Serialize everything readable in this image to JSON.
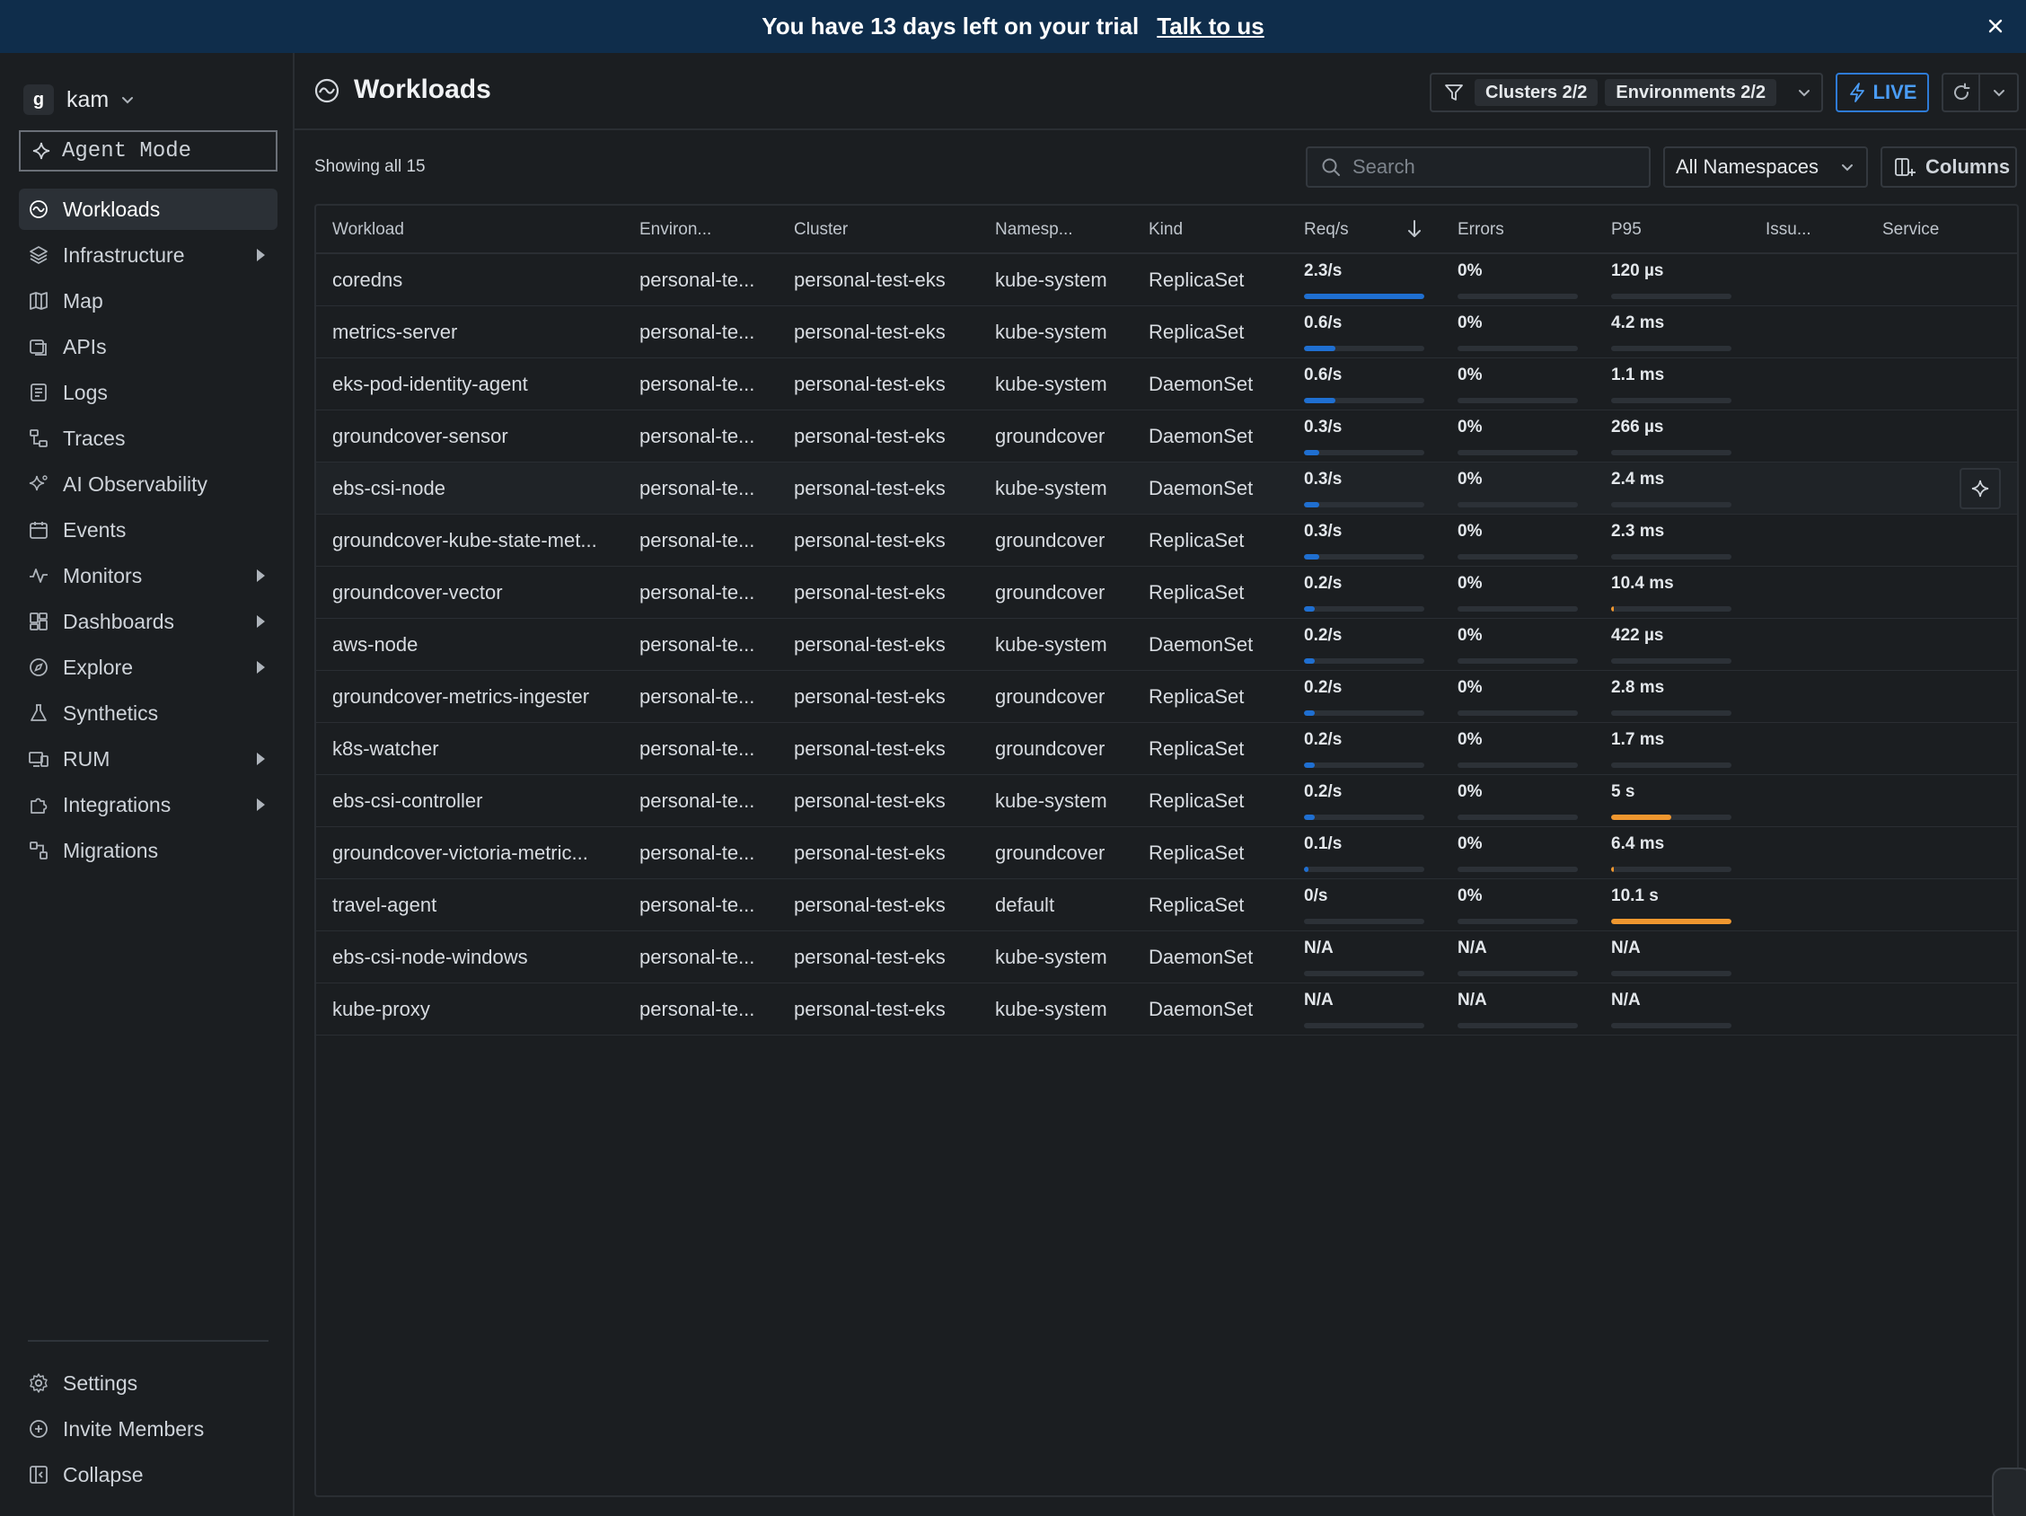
{
  "banner": {
    "message": "You have 13 days left on your trial",
    "link": "Talk to us"
  },
  "sidebar": {
    "org_initial": "g",
    "org_name": "kam",
    "agent_mode": "Agent Mode",
    "items": [
      {
        "label": "Workloads",
        "icon": "workloads-icon",
        "active": true,
        "submenu": false
      },
      {
        "label": "Infrastructure",
        "icon": "layers-icon",
        "active": false,
        "submenu": true
      },
      {
        "label": "Map",
        "icon": "map-icon",
        "active": false,
        "submenu": false
      },
      {
        "label": "APIs",
        "icon": "api-icon",
        "active": false,
        "submenu": false
      },
      {
        "label": "Logs",
        "icon": "logs-icon",
        "active": false,
        "submenu": false
      },
      {
        "label": "Traces",
        "icon": "traces-icon",
        "active": false,
        "submenu": false
      },
      {
        "label": "AI Observability",
        "icon": "ai-sparkle-icon",
        "active": false,
        "submenu": false
      },
      {
        "label": "Events",
        "icon": "calendar-icon",
        "active": false,
        "submenu": false
      },
      {
        "label": "Monitors",
        "icon": "pulse-icon",
        "active": false,
        "submenu": true
      },
      {
        "label": "Dashboards",
        "icon": "dashboard-icon",
        "active": false,
        "submenu": true
      },
      {
        "label": "Explore",
        "icon": "explore-icon",
        "active": false,
        "submenu": true
      },
      {
        "label": "Synthetics",
        "icon": "flask-icon",
        "active": false,
        "submenu": false
      },
      {
        "label": "RUM",
        "icon": "devices-icon",
        "active": false,
        "submenu": true
      },
      {
        "label": "Integrations",
        "icon": "puzzle-icon",
        "active": false,
        "submenu": true
      },
      {
        "label": "Migrations",
        "icon": "migrate-icon",
        "active": false,
        "submenu": false
      }
    ],
    "bottom": [
      {
        "label": "Settings",
        "icon": "gear-icon"
      },
      {
        "label": "Invite Members",
        "icon": "plus-circle-icon"
      },
      {
        "label": "Collapse",
        "icon": "collapse-icon"
      }
    ]
  },
  "header": {
    "title": "Workloads",
    "filters": {
      "clusters": "Clusters 2/2",
      "environments": "Environments 2/2"
    },
    "live": "LIVE"
  },
  "toolbar": {
    "showing": "Showing all 15",
    "search_placeholder": "Search",
    "namespace_select": "All Namespaces",
    "columns": "Columns"
  },
  "colors": {
    "banner_bg": "#0f2d4b",
    "accent_blue": "#2e7bd6",
    "bar_blue": "#1f6fd1",
    "bar_orange": "#f0972f"
  },
  "table": {
    "columns": [
      "Workload",
      "Environ...",
      "Cluster",
      "Namesp...",
      "Kind",
      "Req/s",
      "Errors",
      "P95",
      "Issu...",
      "Service"
    ],
    "rows": [
      {
        "workload": "coredns",
        "env": "personal-te...",
        "cluster": "personal-test-eks",
        "namespace": "kube-system",
        "kind": "ReplicaSet",
        "req": "2.3/s",
        "req_frac": 1.0,
        "err": "0%",
        "err_frac": 0,
        "p95": "120 µs",
        "p95_frac": 0.0
      },
      {
        "workload": "metrics-server",
        "env": "personal-te...",
        "cluster": "personal-test-eks",
        "namespace": "kube-system",
        "kind": "ReplicaSet",
        "req": "0.6/s",
        "req_frac": 0.26,
        "err": "0%",
        "err_frac": 0,
        "p95": "4.2 ms",
        "p95_frac": 0.0
      },
      {
        "workload": "eks-pod-identity-agent",
        "env": "personal-te...",
        "cluster": "personal-test-eks",
        "namespace": "kube-system",
        "kind": "DaemonSet",
        "req": "0.6/s",
        "req_frac": 0.26,
        "err": "0%",
        "err_frac": 0,
        "p95": "1.1 ms",
        "p95_frac": 0.0
      },
      {
        "workload": "groundcover-sensor",
        "env": "personal-te...",
        "cluster": "personal-test-eks",
        "namespace": "groundcover",
        "kind": "DaemonSet",
        "req": "0.3/s",
        "req_frac": 0.13,
        "err": "0%",
        "err_frac": 0,
        "p95": "266 µs",
        "p95_frac": 0.0
      },
      {
        "workload": "ebs-csi-node",
        "env": "personal-te...",
        "cluster": "personal-test-eks",
        "namespace": "kube-system",
        "kind": "DaemonSet",
        "req": "0.3/s",
        "req_frac": 0.13,
        "err": "0%",
        "err_frac": 0,
        "p95": "2.4 ms",
        "p95_frac": 0.0,
        "hover": true
      },
      {
        "workload": "groundcover-kube-state-met...",
        "env": "personal-te...",
        "cluster": "personal-test-eks",
        "namespace": "groundcover",
        "kind": "ReplicaSet",
        "req": "0.3/s",
        "req_frac": 0.13,
        "err": "0%",
        "err_frac": 0,
        "p95": "2.3 ms",
        "p95_frac": 0.0
      },
      {
        "workload": "groundcover-vector",
        "env": "personal-te...",
        "cluster": "personal-test-eks",
        "namespace": "groundcover",
        "kind": "ReplicaSet",
        "req": "0.2/s",
        "req_frac": 0.09,
        "err": "0%",
        "err_frac": 0,
        "p95": "10.4 ms",
        "p95_frac": 0.01
      },
      {
        "workload": "aws-node",
        "env": "personal-te...",
        "cluster": "personal-test-eks",
        "namespace": "kube-system",
        "kind": "DaemonSet",
        "req": "0.2/s",
        "req_frac": 0.09,
        "err": "0%",
        "err_frac": 0,
        "p95": "422 µs",
        "p95_frac": 0.0
      },
      {
        "workload": "groundcover-metrics-ingester",
        "env": "personal-te...",
        "cluster": "personal-test-eks",
        "namespace": "groundcover",
        "kind": "ReplicaSet",
        "req": "0.2/s",
        "req_frac": 0.09,
        "err": "0%",
        "err_frac": 0,
        "p95": "2.8 ms",
        "p95_frac": 0.0
      },
      {
        "workload": "k8s-watcher",
        "env": "personal-te...",
        "cluster": "personal-test-eks",
        "namespace": "groundcover",
        "kind": "ReplicaSet",
        "req": "0.2/s",
        "req_frac": 0.09,
        "err": "0%",
        "err_frac": 0,
        "p95": "1.7 ms",
        "p95_frac": 0.0
      },
      {
        "workload": "ebs-csi-controller",
        "env": "personal-te...",
        "cluster": "personal-test-eks",
        "namespace": "kube-system",
        "kind": "ReplicaSet",
        "req": "0.2/s",
        "req_frac": 0.09,
        "err": "0%",
        "err_frac": 0,
        "p95": "5 s",
        "p95_frac": 0.5
      },
      {
        "workload": "groundcover-victoria-metric...",
        "env": "personal-te...",
        "cluster": "personal-test-eks",
        "namespace": "groundcover",
        "kind": "ReplicaSet",
        "req": "0.1/s",
        "req_frac": 0.04,
        "err": "0%",
        "err_frac": 0,
        "p95": "6.4 ms",
        "p95_frac": 0.01
      },
      {
        "workload": "travel-agent",
        "env": "personal-te...",
        "cluster": "personal-test-eks",
        "namespace": "default",
        "kind": "ReplicaSet",
        "req": "0/s",
        "req_frac": 0,
        "err": "0%",
        "err_frac": 0,
        "p95": "10.1 s",
        "p95_frac": 1.0
      },
      {
        "workload": "ebs-csi-node-windows",
        "env": "personal-te...",
        "cluster": "personal-test-eks",
        "namespace": "kube-system",
        "kind": "DaemonSet",
        "req": "N/A",
        "req_frac": 0,
        "err": "N/A",
        "err_frac": 0,
        "p95": "N/A",
        "p95_frac": 0
      },
      {
        "workload": "kube-proxy",
        "env": "personal-te...",
        "cluster": "personal-test-eks",
        "namespace": "kube-system",
        "kind": "DaemonSet",
        "req": "N/A",
        "req_frac": 0,
        "err": "N/A",
        "err_frac": 0,
        "p95": "N/A",
        "p95_frac": 0
      }
    ]
  }
}
